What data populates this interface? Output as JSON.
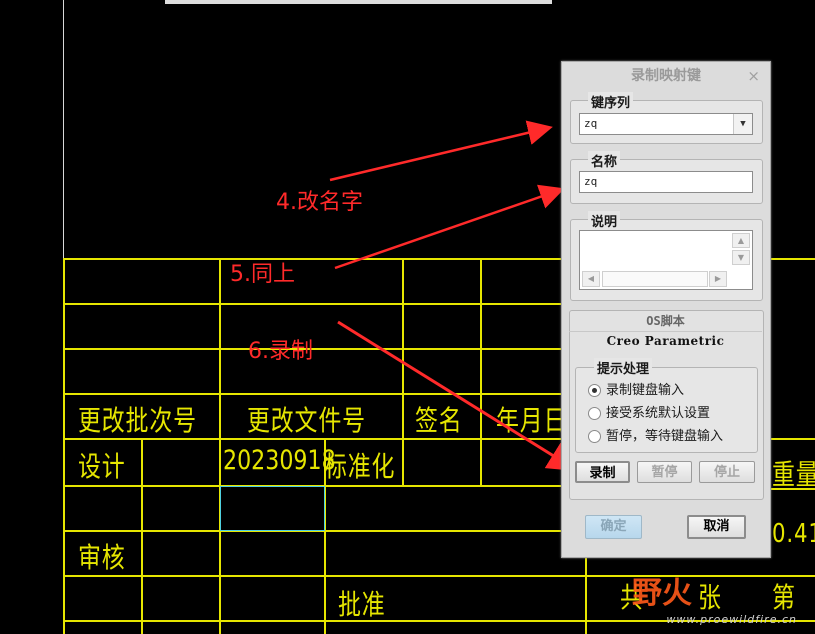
{
  "title_block": {
    "row_labels": {
      "change_batch_no": "更改批次号",
      "change_doc_no": "更改文件号",
      "signature": "签名",
      "date": "年月日",
      "design": "设计",
      "design_doc": "20230918",
      "standardization": "标准化",
      "review": "审核",
      "approve": "批准",
      "weight": "重量",
      "weight_value": "0.41",
      "sheet_total": "共",
      "sheet_unit": "张",
      "sheet_no": "第"
    }
  },
  "annotations": {
    "step4": "4.改名字",
    "step5": "5.同上",
    "step6": "6.录制"
  },
  "dialog": {
    "title": "录制映射键",
    "close": "×",
    "key_sequence": {
      "label": "键序列",
      "value": "zq"
    },
    "name": {
      "label": "名称",
      "value": "zq"
    },
    "description": {
      "label": "说明",
      "value": ""
    },
    "tab": {
      "label": "OS脚本"
    },
    "app_name": "Creo Parametric",
    "prompt_handling": {
      "label": "提示处理",
      "options": [
        "录制键盘输入",
        "接受系统默认设置",
        "暂停，等待键盘输入"
      ],
      "selected": "录制键盘输入"
    },
    "buttons": {
      "record": "录制",
      "pause": "暂停",
      "stop": "停止",
      "ok": "确定",
      "cancel": "取消"
    }
  },
  "watermark": {
    "logo": "野火",
    "url": "www.proewildfire.cn"
  },
  "colors": {
    "cad_line": "#e6e600",
    "annotation": "#ff2a2a",
    "selection": "#4fd0e0"
  }
}
